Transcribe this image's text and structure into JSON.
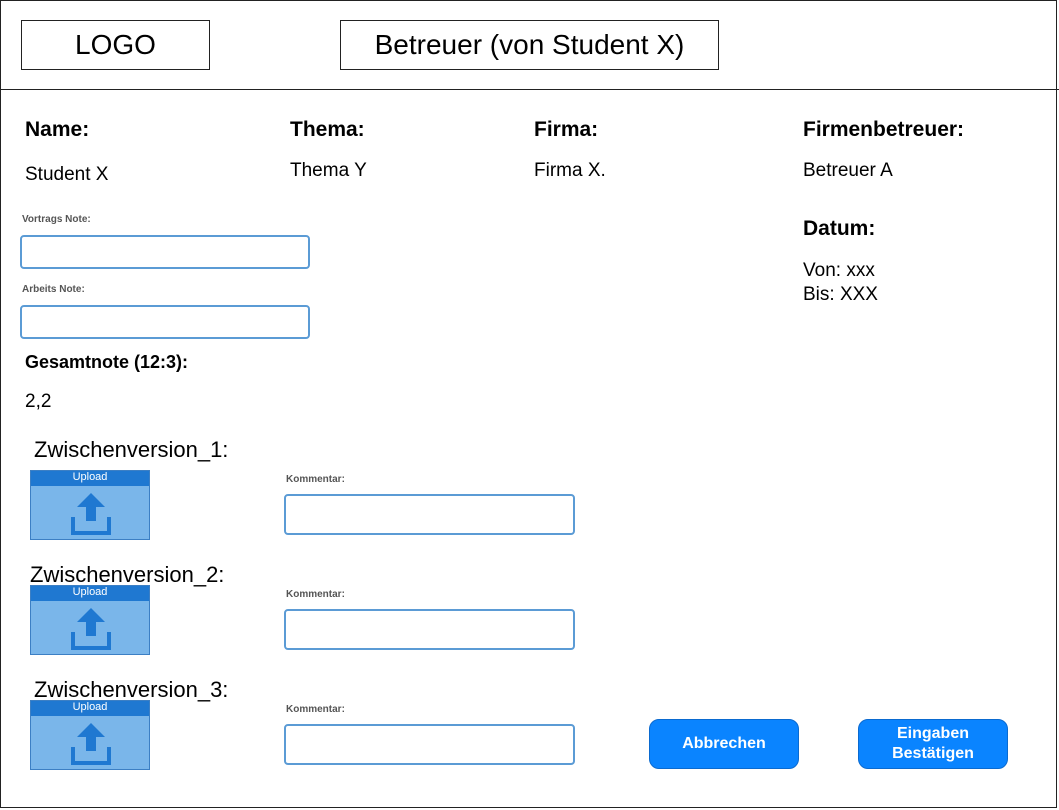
{
  "header": {
    "logo": "LOGO",
    "title": "Betreuer (von Student X)"
  },
  "info": {
    "name_label": "Name:",
    "name_value": "Student X",
    "thema_label": "Thema:",
    "thema_value": "Thema Y",
    "firma_label": "Firma:",
    "firma_value": "Firma X.",
    "firmenbetreuer_label": "Firmenbetreuer:",
    "firmenbetreuer_value": "Betreuer A",
    "datum_label": "Datum:",
    "von": "Von: xxx",
    "bis": "Bis: XXX"
  },
  "grades": {
    "vortrag_label": "Vortrags Note:",
    "vortrag_value": "",
    "arbeit_label": "Arbeits Note:",
    "arbeit_value": "",
    "gesamt_label": "Gesamtnote (12:3):",
    "gesamt_value": "2,2"
  },
  "versions": [
    {
      "title": "Zwischenversion_1:",
      "upload_label": "Upload",
      "comment_label": "Kommentar:",
      "comment_value": ""
    },
    {
      "title": "Zwischenversion_2:",
      "upload_label": "Upload",
      "comment_label": "Kommentar:",
      "comment_value": ""
    },
    {
      "title": "Zwischenversion_3:",
      "upload_label": "Upload",
      "comment_label": "Kommentar:",
      "comment_value": ""
    }
  ],
  "buttons": {
    "cancel": "Abbrechen",
    "confirm_line1": "Eingaben",
    "confirm_line2": "Bestätigen"
  },
  "colors": {
    "accent": "#0a84ff",
    "field_border": "#5b9bd5",
    "upload_fill": "#7ab6ea",
    "upload_bar": "#1f78d1"
  }
}
